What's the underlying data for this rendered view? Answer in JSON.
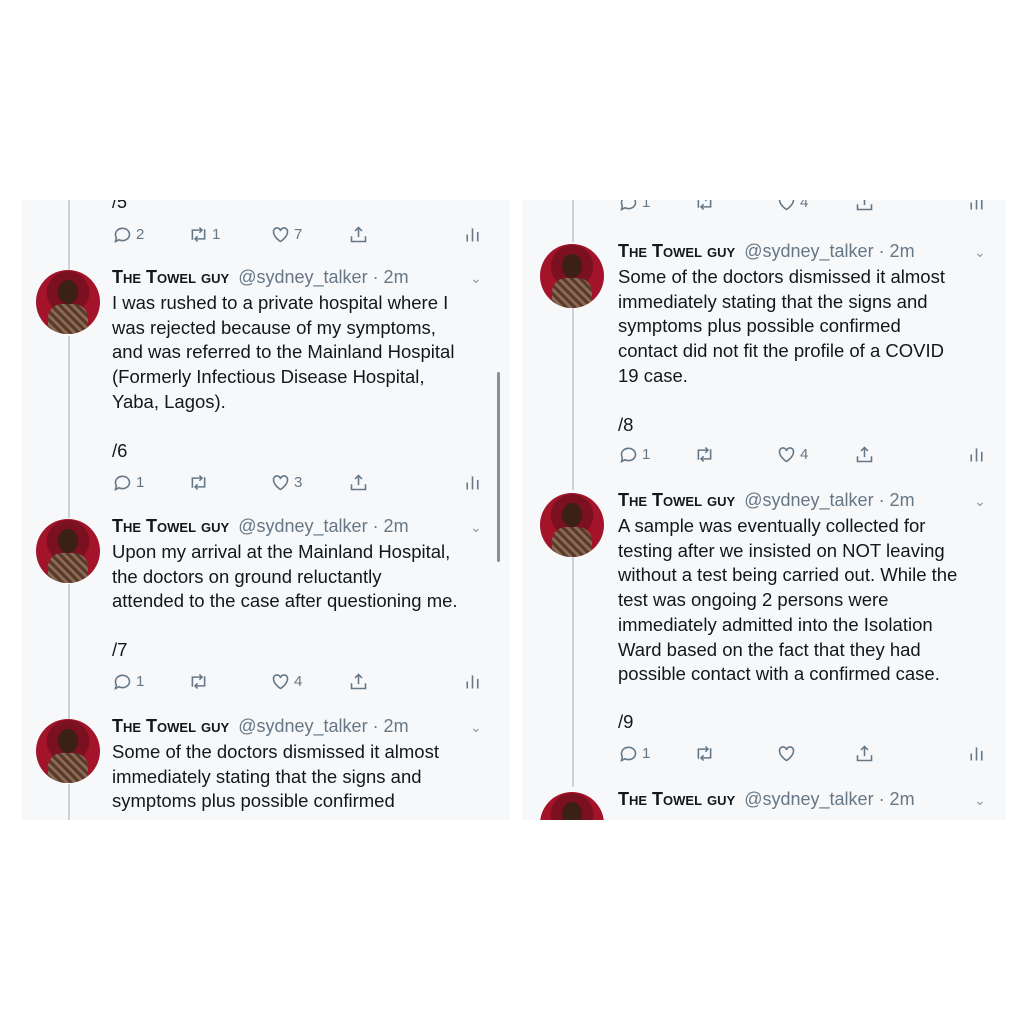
{
  "left": {
    "top_partial_text": "/5",
    "top_actions": {
      "reply": "2",
      "retweet": "1",
      "like": "7"
    },
    "tweets": [
      {
        "name": "The Towel guy",
        "handle": "@sydney_talker · 2m",
        "text": "I was rushed to a private hospital where I\nwas rejected because of my symptoms,\nand was referred to the Mainland Hospital\n(Formerly Infectious Disease Hospital,\nYaba, Lagos).",
        "counter": "/6",
        "reply": "1",
        "retweet": "",
        "like": "3"
      },
      {
        "name": "The Towel guy",
        "handle": "@sydney_talker · 2m",
        "text": "Upon my arrival at the Mainland Hospital,\nthe doctors on ground reluctantly\nattended to the case after questioning me.",
        "counter": "/7",
        "reply": "1",
        "retweet": "",
        "like": "4"
      },
      {
        "name": "The Towel guy",
        "handle": "@sydney_talker · 2m",
        "text": "Some of the doctors dismissed it almost\nimmediately stating that the signs and\nsymptoms plus possible confirmed",
        "counter": "",
        "reply": "",
        "retweet": "",
        "like": ""
      }
    ]
  },
  "right": {
    "top_actions": {
      "reply": "1",
      "retweet": "",
      "like": "4"
    },
    "tweets": [
      {
        "name": "The Towel guy",
        "handle": "@sydney_talker · 2m",
        "text": "Some of the doctors dismissed it almost\nimmediately stating that the signs and\nsymptoms plus possible confirmed\ncontact did not fit the profile of a COVID\n19 case.",
        "counter": "/8",
        "reply": "1",
        "retweet": "",
        "like": "4"
      },
      {
        "name": "The Towel guy",
        "handle": "@sydney_talker · 2m",
        "text": "A sample was eventually collected for\ntesting after we insisted on NOT leaving\nwithout a test being carried out. While the\ntest was ongoing 2 persons were\nimmediately admitted into the Isolation\nWard based on the fact that they had\npossible contact with a confirmed case.",
        "counter": "/9",
        "reply": "1",
        "retweet": "",
        "like": ""
      },
      {
        "name": "The Towel guy",
        "handle": "@sydney_talker · 2m",
        "text": "",
        "counter": "",
        "reply": "",
        "retweet": "",
        "like": ""
      }
    ]
  }
}
